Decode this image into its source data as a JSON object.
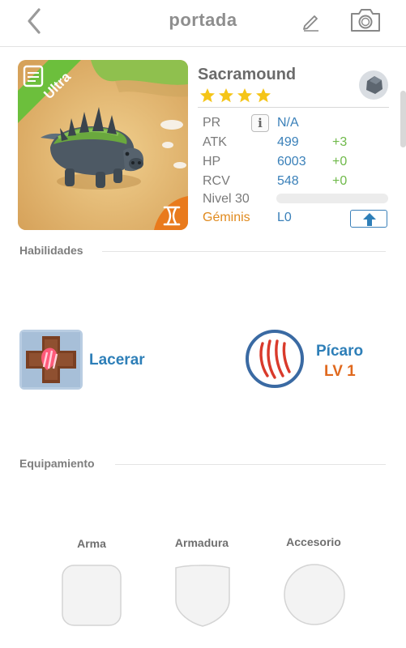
{
  "header": {
    "title": "portada",
    "back_icon": "chevron-left-icon",
    "edit_icon": "pencil-icon",
    "camera_icon": "camera-icon"
  },
  "creature": {
    "name": "Sacramound",
    "rarity_badge": "Ultra",
    "stars": 4,
    "element_icon": "rock-element-icon",
    "sign_icon": "gemini-sign-icon",
    "stats": {
      "pr": {
        "label": "PR",
        "value": "N/A"
      },
      "atk": {
        "label": "ATK",
        "value": "499",
        "bonus": "+3"
      },
      "hp": {
        "label": "HP",
        "value": "6003",
        "bonus": "+0"
      },
      "rcv": {
        "label": "RCV",
        "value": "548",
        "bonus": "+0"
      },
      "level": {
        "label": "Nivel 30",
        "progress": 0
      },
      "sign": {
        "label": "Géminis",
        "value": "L0"
      }
    }
  },
  "abilities": {
    "title": "Habilidades",
    "skill": {
      "name": "Lacerar",
      "icon": "lacerate-skill-icon"
    },
    "trait": {
      "name": "Pícaro",
      "level": "LV 1",
      "icon": "claw-marks-icon"
    }
  },
  "equipment": {
    "title": "Equipamiento",
    "slots": [
      {
        "label": "Arma",
        "icon": "weapon-slot-icon"
      },
      {
        "label": "Armadura",
        "icon": "armor-slot-icon"
      },
      {
        "label": "Accesorio",
        "icon": "accessory-slot-icon"
      }
    ]
  },
  "colors": {
    "accent_blue": "#3a80b9",
    "bonus_green": "#6fb94a",
    "sign_orange": "#e08a1e",
    "star_yellow": "#f5c518",
    "ultra_green": "#6cbf3c"
  }
}
